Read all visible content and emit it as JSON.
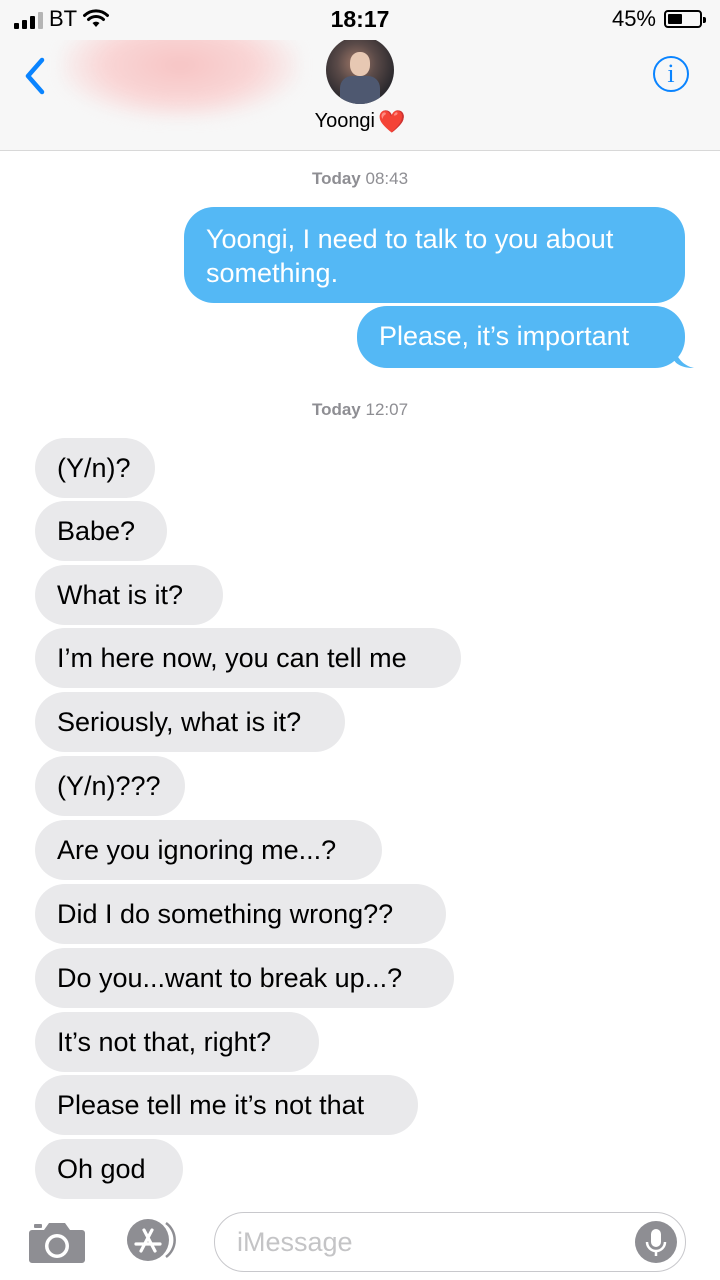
{
  "status_bar": {
    "carrier": "BT",
    "time": "18:17",
    "battery_percent": "45%",
    "battery_level": 0.45
  },
  "header": {
    "contact_name": "Yoongi",
    "contact_emoji": "❤️",
    "icons": [
      "chevron-left-icon",
      "avatar",
      "info-icon"
    ]
  },
  "conversation": {
    "stamps": [
      {
        "day": "Today",
        "time": "08:43"
      },
      {
        "day": "Today",
        "time": "12:07"
      }
    ],
    "sent": [
      "Yoongi, I need to talk to you about something.",
      "Please, it’s important"
    ],
    "received": [
      "(Y/n)?",
      "Babe?",
      "What is it?",
      "I’m here now, you can tell me",
      "Seriously, what is it?",
      "(Y/n)???",
      "Are you ignoring me...?",
      "Did I do something wrong??",
      "Do you...want to break up...?",
      "It’s not that, right?",
      "Please tell me it’s not that",
      "Oh god"
    ]
  },
  "input_bar": {
    "placeholder": "iMessage",
    "value": "",
    "icons": [
      "camera-icon",
      "app-store-icon",
      "microphone-icon"
    ]
  },
  "colors": {
    "sent_bubble": "#54b8f5",
    "received_bubble": "#e9e9eb",
    "accent": "#0a84ff",
    "heart": "#e0242c"
  }
}
